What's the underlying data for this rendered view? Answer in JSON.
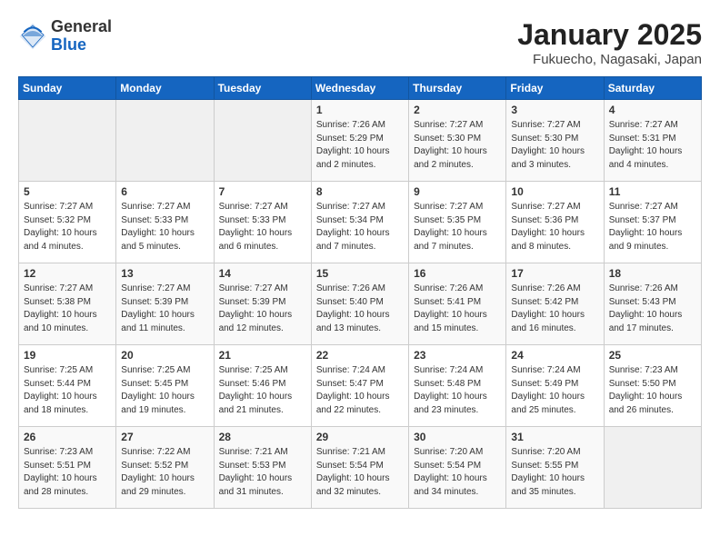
{
  "header": {
    "logo_general": "General",
    "logo_blue": "Blue",
    "title": "January 2025",
    "location": "Fukuecho, Nagasaki, Japan"
  },
  "days_of_week": [
    "Sunday",
    "Monday",
    "Tuesday",
    "Wednesday",
    "Thursday",
    "Friday",
    "Saturday"
  ],
  "weeks": [
    [
      {
        "day": "",
        "content": ""
      },
      {
        "day": "",
        "content": ""
      },
      {
        "day": "",
        "content": ""
      },
      {
        "day": "1",
        "content": "Sunrise: 7:26 AM\nSunset: 5:29 PM\nDaylight: 10 hours\nand 2 minutes."
      },
      {
        "day": "2",
        "content": "Sunrise: 7:27 AM\nSunset: 5:30 PM\nDaylight: 10 hours\nand 2 minutes."
      },
      {
        "day": "3",
        "content": "Sunrise: 7:27 AM\nSunset: 5:30 PM\nDaylight: 10 hours\nand 3 minutes."
      },
      {
        "day": "4",
        "content": "Sunrise: 7:27 AM\nSunset: 5:31 PM\nDaylight: 10 hours\nand 4 minutes."
      }
    ],
    [
      {
        "day": "5",
        "content": "Sunrise: 7:27 AM\nSunset: 5:32 PM\nDaylight: 10 hours\nand 4 minutes."
      },
      {
        "day": "6",
        "content": "Sunrise: 7:27 AM\nSunset: 5:33 PM\nDaylight: 10 hours\nand 5 minutes."
      },
      {
        "day": "7",
        "content": "Sunrise: 7:27 AM\nSunset: 5:33 PM\nDaylight: 10 hours\nand 6 minutes."
      },
      {
        "day": "8",
        "content": "Sunrise: 7:27 AM\nSunset: 5:34 PM\nDaylight: 10 hours\nand 7 minutes."
      },
      {
        "day": "9",
        "content": "Sunrise: 7:27 AM\nSunset: 5:35 PM\nDaylight: 10 hours\nand 7 minutes."
      },
      {
        "day": "10",
        "content": "Sunrise: 7:27 AM\nSunset: 5:36 PM\nDaylight: 10 hours\nand 8 minutes."
      },
      {
        "day": "11",
        "content": "Sunrise: 7:27 AM\nSunset: 5:37 PM\nDaylight: 10 hours\nand 9 minutes."
      }
    ],
    [
      {
        "day": "12",
        "content": "Sunrise: 7:27 AM\nSunset: 5:38 PM\nDaylight: 10 hours\nand 10 minutes."
      },
      {
        "day": "13",
        "content": "Sunrise: 7:27 AM\nSunset: 5:39 PM\nDaylight: 10 hours\nand 11 minutes."
      },
      {
        "day": "14",
        "content": "Sunrise: 7:27 AM\nSunset: 5:39 PM\nDaylight: 10 hours\nand 12 minutes."
      },
      {
        "day": "15",
        "content": "Sunrise: 7:26 AM\nSunset: 5:40 PM\nDaylight: 10 hours\nand 13 minutes."
      },
      {
        "day": "16",
        "content": "Sunrise: 7:26 AM\nSunset: 5:41 PM\nDaylight: 10 hours\nand 15 minutes."
      },
      {
        "day": "17",
        "content": "Sunrise: 7:26 AM\nSunset: 5:42 PM\nDaylight: 10 hours\nand 16 minutes."
      },
      {
        "day": "18",
        "content": "Sunrise: 7:26 AM\nSunset: 5:43 PM\nDaylight: 10 hours\nand 17 minutes."
      }
    ],
    [
      {
        "day": "19",
        "content": "Sunrise: 7:25 AM\nSunset: 5:44 PM\nDaylight: 10 hours\nand 18 minutes."
      },
      {
        "day": "20",
        "content": "Sunrise: 7:25 AM\nSunset: 5:45 PM\nDaylight: 10 hours\nand 19 minutes."
      },
      {
        "day": "21",
        "content": "Sunrise: 7:25 AM\nSunset: 5:46 PM\nDaylight: 10 hours\nand 21 minutes."
      },
      {
        "day": "22",
        "content": "Sunrise: 7:24 AM\nSunset: 5:47 PM\nDaylight: 10 hours\nand 22 minutes."
      },
      {
        "day": "23",
        "content": "Sunrise: 7:24 AM\nSunset: 5:48 PM\nDaylight: 10 hours\nand 23 minutes."
      },
      {
        "day": "24",
        "content": "Sunrise: 7:24 AM\nSunset: 5:49 PM\nDaylight: 10 hours\nand 25 minutes."
      },
      {
        "day": "25",
        "content": "Sunrise: 7:23 AM\nSunset: 5:50 PM\nDaylight: 10 hours\nand 26 minutes."
      }
    ],
    [
      {
        "day": "26",
        "content": "Sunrise: 7:23 AM\nSunset: 5:51 PM\nDaylight: 10 hours\nand 28 minutes."
      },
      {
        "day": "27",
        "content": "Sunrise: 7:22 AM\nSunset: 5:52 PM\nDaylight: 10 hours\nand 29 minutes."
      },
      {
        "day": "28",
        "content": "Sunrise: 7:21 AM\nSunset: 5:53 PM\nDaylight: 10 hours\nand 31 minutes."
      },
      {
        "day": "29",
        "content": "Sunrise: 7:21 AM\nSunset: 5:54 PM\nDaylight: 10 hours\nand 32 minutes."
      },
      {
        "day": "30",
        "content": "Sunrise: 7:20 AM\nSunset: 5:54 PM\nDaylight: 10 hours\nand 34 minutes."
      },
      {
        "day": "31",
        "content": "Sunrise: 7:20 AM\nSunset: 5:55 PM\nDaylight: 10 hours\nand 35 minutes."
      },
      {
        "day": "",
        "content": ""
      }
    ]
  ]
}
